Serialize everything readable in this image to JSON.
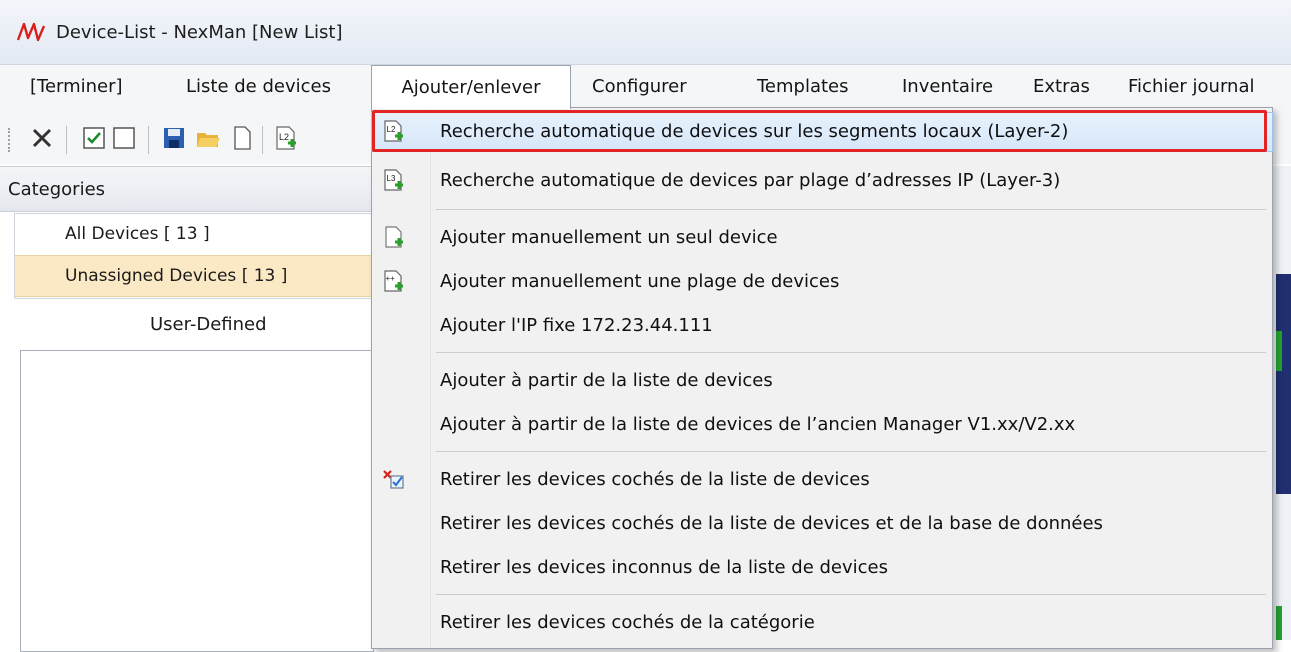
{
  "window": {
    "title": "Device-List - NexMan [New List]"
  },
  "menubar": {
    "items": [
      {
        "label": "[Terminer]"
      },
      {
        "label": "Liste de devices"
      },
      {
        "label": "Ajouter/enlever"
      },
      {
        "label": "Configurer"
      },
      {
        "label": "Templates"
      },
      {
        "label": "Inventaire"
      },
      {
        "label": "Extras"
      },
      {
        "label": "Fichier journal"
      }
    ],
    "open_menu": "Ajouter/enlever"
  },
  "toolbar": {
    "buttons": [
      "close-icon",
      "checkbox-checked-icon",
      "checkbox-empty-icon",
      "save-icon",
      "open-folder-icon",
      "new-document-icon",
      "layer2-search-icon"
    ]
  },
  "categories": {
    "header": "Categories",
    "items": [
      {
        "label": "All Devices [ 13 ]"
      },
      {
        "label": "Unassigned Devices [ 13 ]"
      }
    ],
    "selected": "Unassigned Devices [ 13 ]",
    "user_defined_label": "User-Defined"
  },
  "dropdown": {
    "items": [
      {
        "label": "Recherche automatique de devices sur les segments locaux (Layer-2)",
        "icon": "layer2-search-icon"
      },
      {
        "label": "Recherche automatique de devices par plage d’adresses IP (Layer-3)",
        "icon": "layer3-search-icon"
      },
      {
        "label": "Ajouter manuellement un seul device",
        "icon": "add-device-icon"
      },
      {
        "label": "Ajouter manuellement une plage de devices",
        "icon": "add-range-icon"
      },
      {
        "label": "Ajouter l'IP fixe 172.23.44.111",
        "icon": ""
      },
      {
        "label": "Ajouter à partir de la liste de devices",
        "icon": ""
      },
      {
        "label": "Ajouter à partir de la liste de devices de l’ancien Manager V1.xx/V2.xx",
        "icon": ""
      },
      {
        "label": "Retirer les devices cochés de la liste de devices",
        "icon": "remove-checked-icon"
      },
      {
        "label": "Retirer les devices cochés de la liste de devices et de la base de données",
        "icon": ""
      },
      {
        "label": "Retirer les devices inconnus de la liste de devices",
        "icon": ""
      },
      {
        "label": "Retirer les devices cochés de la catégorie",
        "icon": ""
      }
    ],
    "highlighted_index": 0
  },
  "colors": {
    "highlight_border": "#e22424",
    "hover_bg": "#d6e7fa",
    "selected_category_bg": "#fbe9c5",
    "logo_red": "#d8211c"
  }
}
